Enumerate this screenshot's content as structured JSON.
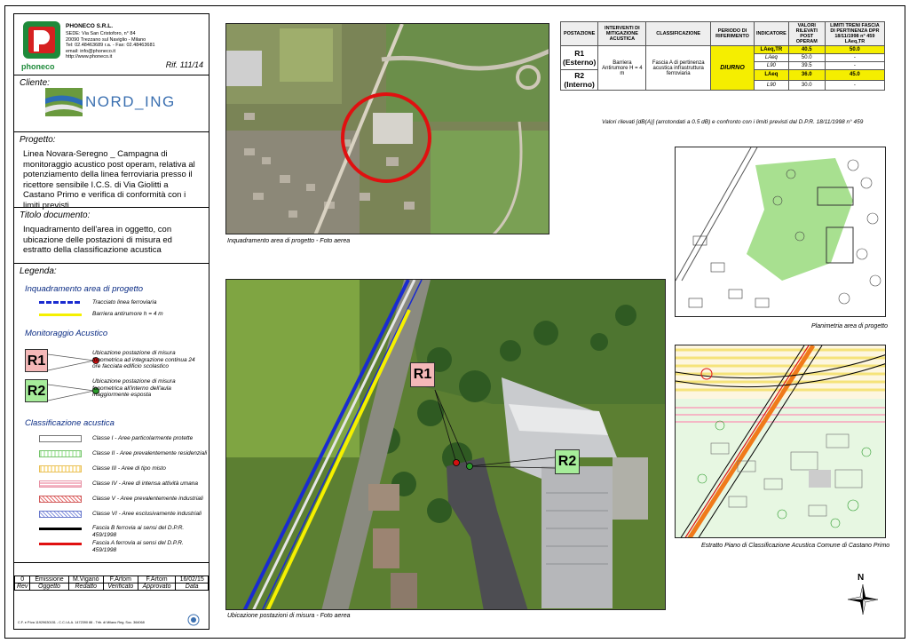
{
  "company": {
    "name": "PHONECO S.R.L.",
    "lines": [
      "SEDE: Via San Cristoforo, n° 84",
      "20090 Trezzano sul Naviglio - Milano",
      "Tel: 02.48463689 r.a. - Fax: 02.48463681",
      "email: info@phoneco.it",
      "http://www.phoneco.it"
    ],
    "logo_text": "phoneco",
    "ref": "Rif. 111/14"
  },
  "client": {
    "label": "Cliente:",
    "logo_text": "NORD_ING"
  },
  "project": {
    "label": "Progetto:",
    "text": "Linea Novara-Seregno _ Campagna di monitoraggio acustico post operam, relativa al potenziamento della linea ferroviaria presso il ricettore sensibile I.C.S. di Via Giolitti a Castano Primo e verifica di conformità con i limiti previsti"
  },
  "doc_title": {
    "label": "Titolo documento:",
    "text": "Inquadramento dell'area in oggetto, con ubicazione delle postazioni di misura ed estratto della classificazione acustica"
  },
  "legend": {
    "label": "Legenda:",
    "sec1": "Inquadramento area di progetto",
    "rail_track": "Tracciato linea ferroviaria",
    "barrier": "Barriera antirumore h = 4 m",
    "sec2": "Monitoraggio Acustico",
    "r1": "R1",
    "r1_text": "Ubicazione postazione di misura fonometrica ad integrazione continua 24 ore facciata edificio scolastico",
    "r2": "R2",
    "r2_text": "Ubicazione postazione di misura fonometrica all'interno dell'aula maggiormente esposta",
    "sec3": "Classificazione acustica",
    "classes": [
      "Classe I - Aree particolarmente protette",
      "Classe II - Aree prevalentemente residenziali",
      "Classe III - Aree di tipo misto",
      "Classe IV - Aree di intensa attività umana",
      "Classe V - Aree prevalentemente industriali",
      "Classe VI - Aree esclusivamente industriali",
      "Fascia B ferrovia ai sensi del D.P.R. 459/1998",
      "Fascia A ferrovia ai sensi del D.P.R. 459/1998"
    ],
    "class_colors": [
      "#b9b9b9",
      "#a6dca0",
      "#f6d57a",
      "#f4a4b4",
      "#e77272",
      "#9aa6e0",
      "#000000",
      "#e01010"
    ]
  },
  "revision": {
    "row": [
      "0",
      "Emissione",
      "M.Viganò",
      "F.Artom",
      "F.Artom",
      "16/02/15"
    ],
    "head": [
      "Rev",
      "Oggetto",
      "Redatto",
      "Verificato",
      "Approvato",
      "Data"
    ]
  },
  "footer": "C.F. e P.iva 11929630151 - C.C.I.A.A. 1472390 88 - Trib. di Milano Reg. Soc. 364068",
  "captions": {
    "aerial": "Inquadramento area di progetto - Foto aerea",
    "site": "Ubicazione postazioni di misura - Foto aerea",
    "plan": "Planimetria area di progetto",
    "zoning": "Estratto Piano di Classificazione Acustica Comune di Castano Primo",
    "table_note": "Valori rilevati [dB(A)] (arrotondati a 0.5 dB) e confronto con i limiti previsti dal D.P.R. 18/11/1998 n° 459"
  },
  "table": {
    "headers": [
      "POSTAZIONE",
      "INTERVENTI DI MITIGAZIONE ACUSTICA",
      "CLASSIFICAZIONE",
      "PERIODO DI RIFERIMENTO",
      "INDICATORE",
      "VALORI RILEVATI POST OPERAM",
      "LIMITI TRENI FASCIA DI PERTINENZA DPR 18/11/1998 n° 459 LAeq,TR"
    ],
    "r1_name": "R1",
    "r1_sub": "(Esterno)",
    "r2_name": "R2",
    "r2_sub": "(Interno)",
    "mitigation": "Barriera Antirumore H = 4 m",
    "classification": "Fascia A di pertinenza acustica infrastruttura ferroviaria",
    "period": "DIURNO",
    "rows": [
      {
        "ind": "LAeq,TR",
        "val": "40.5",
        "lim": "50.0"
      },
      {
        "ind": "LAeq",
        "val": "50.0",
        "lim": "-"
      },
      {
        "ind": "L90",
        "val": "39.5",
        "lim": "-"
      },
      {
        "ind": "LAeq",
        "val": "36.0",
        "lim": "45.0"
      },
      {
        "ind": "L90",
        "val": "30.0",
        "lim": "-"
      }
    ]
  },
  "north": "N",
  "map_labels": {
    "r1": "R1",
    "r2": "R2"
  }
}
